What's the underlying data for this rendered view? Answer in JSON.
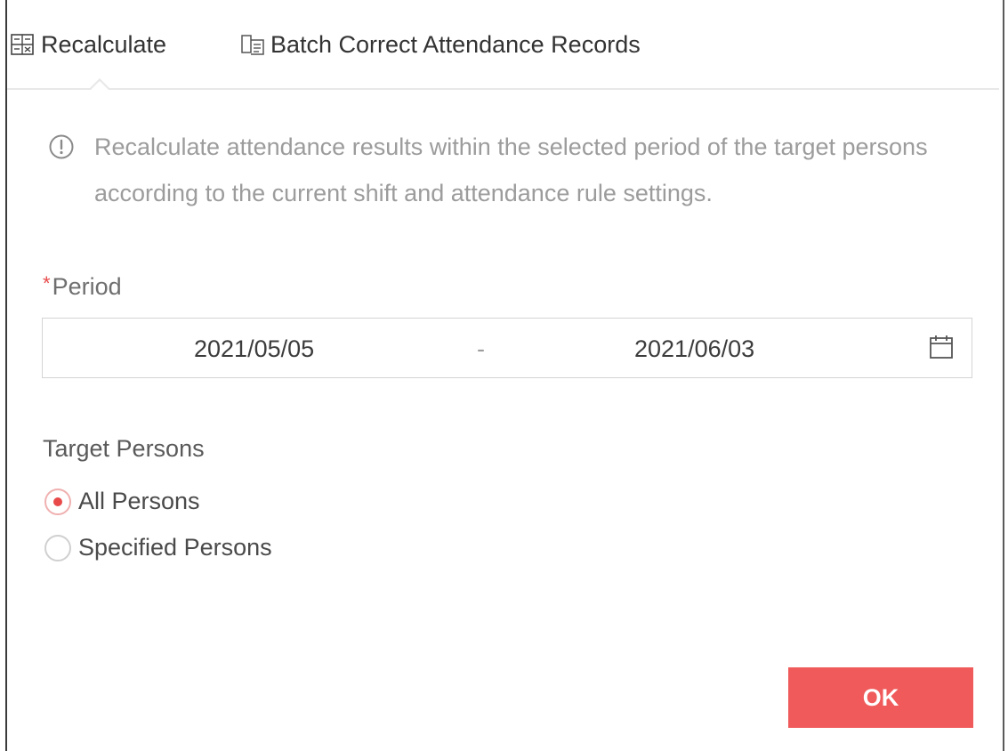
{
  "tabs": [
    {
      "label": "Recalculate",
      "icon": "recalculate-icon",
      "active": true
    },
    {
      "label": "Batch Correct Attendance Records",
      "icon": "batch-correct-icon",
      "active": false
    }
  ],
  "info": {
    "icon": "info-circle-icon",
    "text": "Recalculate attendance results within the selected period of the target persons according to the current shift and attendance rule settings."
  },
  "period": {
    "required_mark": "*",
    "label": "Period",
    "start": "2021/05/05",
    "separator": "-",
    "end": "2021/06/03",
    "icon": "calendar-icon"
  },
  "target": {
    "label": "Target Persons",
    "options": [
      {
        "label": "All Persons",
        "selected": true
      },
      {
        "label": "Specified Persons",
        "selected": false
      }
    ]
  },
  "ok_label": "OK",
  "colors": {
    "accent": "#f05a5a",
    "radio_dot": "#e84a4a",
    "muted_text": "#9c9c9c"
  }
}
